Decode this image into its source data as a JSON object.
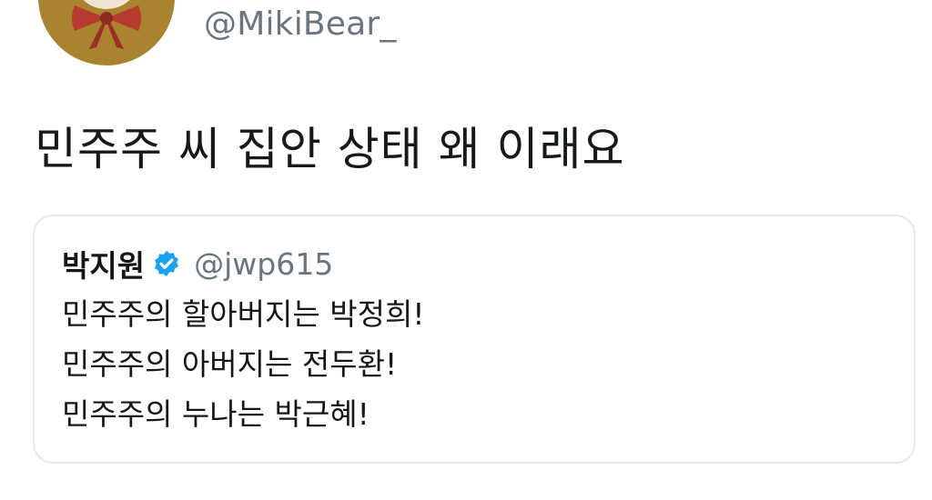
{
  "tweet": {
    "handle": "@MikiBear_",
    "text": "민주주 씨 집안 상태 왜 이래요",
    "avatar_icon": "bear-with-bow-icon"
  },
  "quoted_tweet": {
    "name": "박지원",
    "verified_icon": "verified-badge-icon",
    "handle": "@jwp615",
    "lines": [
      "민주주의 할아버지는 박정희!",
      "민주주의 아버지는 전두환!",
      "민주주의 누나는 박근혜!"
    ]
  },
  "colors": {
    "avatar_bg": "#a9832f",
    "bow": "#b73a2e",
    "verified": "#1da1f2",
    "muted_text": "#697580"
  }
}
